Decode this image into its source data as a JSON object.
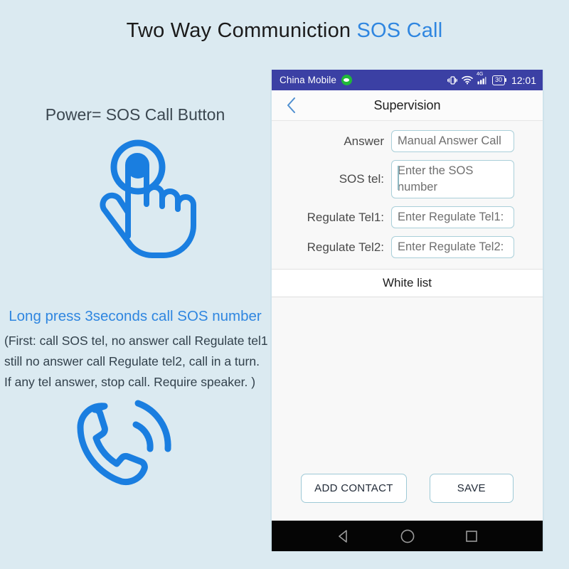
{
  "page": {
    "title_main": "Two Way Communiction ",
    "title_accent": "SOS Call",
    "background_color": "#dbeaf1",
    "accent_color": "#2f86e0"
  },
  "left_panel": {
    "power_label": "Power= SOS Call Button",
    "tap_icon_name": "tap-gesture-icon",
    "longpress_label": "Long press 3seconds call SOS number",
    "note_lines": [
      "(First: call SOS tel, no answer call Regulate tel1",
      "still no answer call Regulate tel2, call in a turn.",
      "If any tel answer, stop call. Require speaker. )"
    ],
    "phone_icon_name": "phone-ringing-icon"
  },
  "phone": {
    "status_bar": {
      "carrier": "China Mobile",
      "wechat_icon": "wechat-icon",
      "vibrate_icon": "vibrate-icon",
      "wifi_icon": "wifi-icon",
      "network_label": "4G",
      "signal_icon": "signal-bars-icon",
      "battery_level": "30",
      "clock": "12:01",
      "background_color": "#3b40a4"
    },
    "app_bar": {
      "back_icon": "chevron-left-icon",
      "title": "Supervision"
    },
    "form": {
      "rows": [
        {
          "label": "Answer",
          "value": "Manual Answer Call",
          "multiline": false,
          "focused": false
        },
        {
          "label": "SOS tel:",
          "value": "Enter the SOS number",
          "multiline": true,
          "focused": true
        },
        {
          "label": "Regulate Tel1:",
          "value": "Enter Regulate Tel1:",
          "multiline": false,
          "focused": false
        },
        {
          "label": "Regulate Tel2:",
          "value": "Enter Regulate Tel2:",
          "multiline": false,
          "focused": false
        }
      ]
    },
    "whitelist_label": "White list",
    "buttons": {
      "add_contact": "ADD CONTACT",
      "save": "SAVE"
    },
    "nav_bar": {
      "back": "nav-back-triangle-icon",
      "home": "nav-home-circle-icon",
      "recents": "nav-recents-square-icon"
    }
  }
}
